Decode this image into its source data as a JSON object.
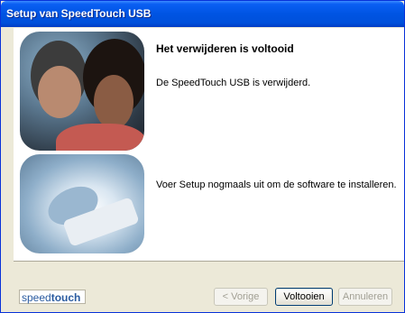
{
  "window": {
    "title": "Setup van SpeedTouch USB"
  },
  "content": {
    "heading": "Het verwijderen is voltooid",
    "message1": "De SpeedTouch USB is verwijderd.",
    "message2": "Voer Setup nogmaals uit om de software te installeren."
  },
  "footer": {
    "logo_prefix": "speed",
    "logo_suffix": "touch",
    "back_label": "< Vorige",
    "finish_label": "Voltooien",
    "cancel_label": "Annuleren"
  },
  "colors": {
    "titlebar": "#0054e3",
    "window_bg": "#ece9d8",
    "logo_text": "#2a5ba0"
  }
}
